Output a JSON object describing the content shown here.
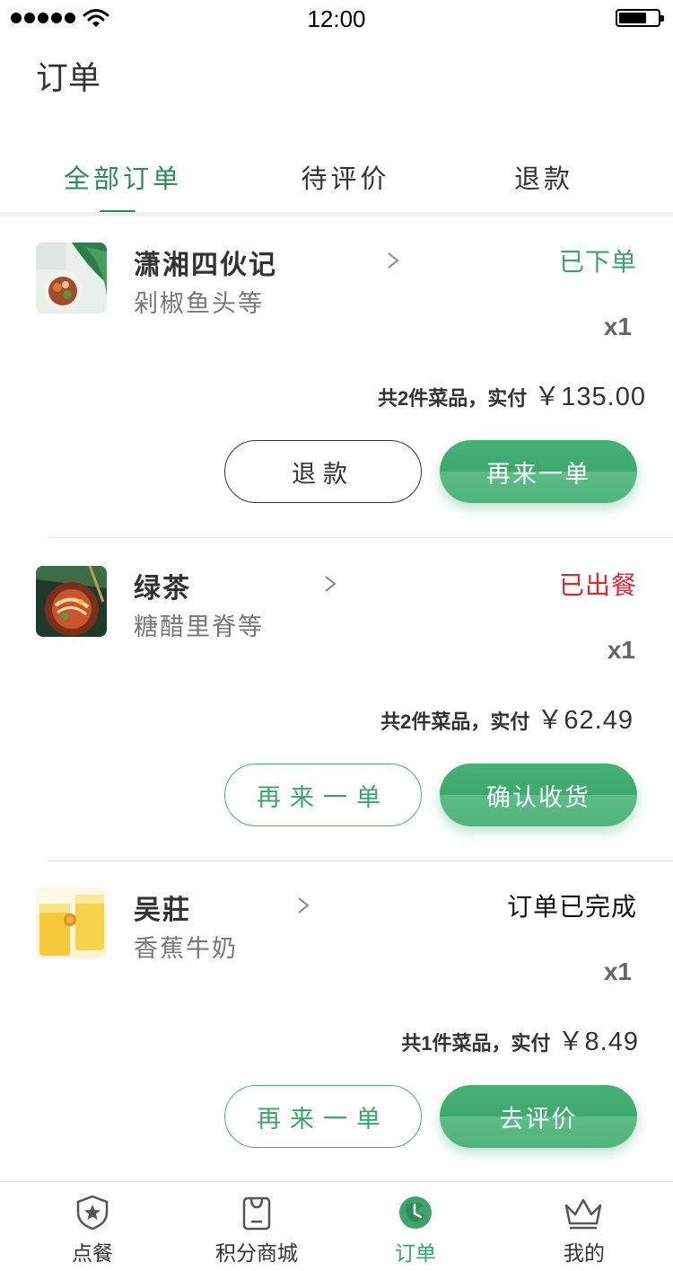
{
  "status_bar": {
    "time": "12:00"
  },
  "page": {
    "title": "订单"
  },
  "tabs": [
    {
      "label": "全部订单",
      "active": true
    },
    {
      "label": "待评价",
      "active": false
    },
    {
      "label": "退款",
      "active": false
    }
  ],
  "orders": [
    {
      "shop": "潇湘四伙记",
      "dishes": "剁椒鱼头等",
      "status": "已下单",
      "status_color": "#3ea36a",
      "quantity": "x1",
      "summary": "共2件菜品，实付",
      "price": "￥135.00",
      "secondary_button": "退款",
      "primary_button": "再来一单"
    },
    {
      "shop": "绿茶",
      "dishes": "糖醋里脊等",
      "status": "已出餐",
      "status_color": "#e0262f",
      "quantity": "x1",
      "summary": "共2件菜品，实付",
      "price": "￥62.49",
      "secondary_button": "再来一单",
      "primary_button": "确认收货"
    },
    {
      "shop": "吴莊",
      "dishes": "香蕉牛奶",
      "status": "订单已完成",
      "status_color": "#111111",
      "quantity": "x1",
      "summary": "共1件菜品，实付",
      "price": "￥8.49",
      "secondary_button": "再来一单",
      "primary_button": "去评价"
    }
  ],
  "bottom_nav": [
    {
      "label": "点餐",
      "icon": "shield-star-icon",
      "active": false
    },
    {
      "label": "积分商城",
      "icon": "shopping-bag-icon",
      "active": false
    },
    {
      "label": "订单",
      "icon": "clock-icon",
      "active": true
    },
    {
      "label": "我的",
      "icon": "crown-icon",
      "active": false
    }
  ],
  "colors": {
    "accent": "#3ea36a",
    "alert": "#e0262f"
  }
}
